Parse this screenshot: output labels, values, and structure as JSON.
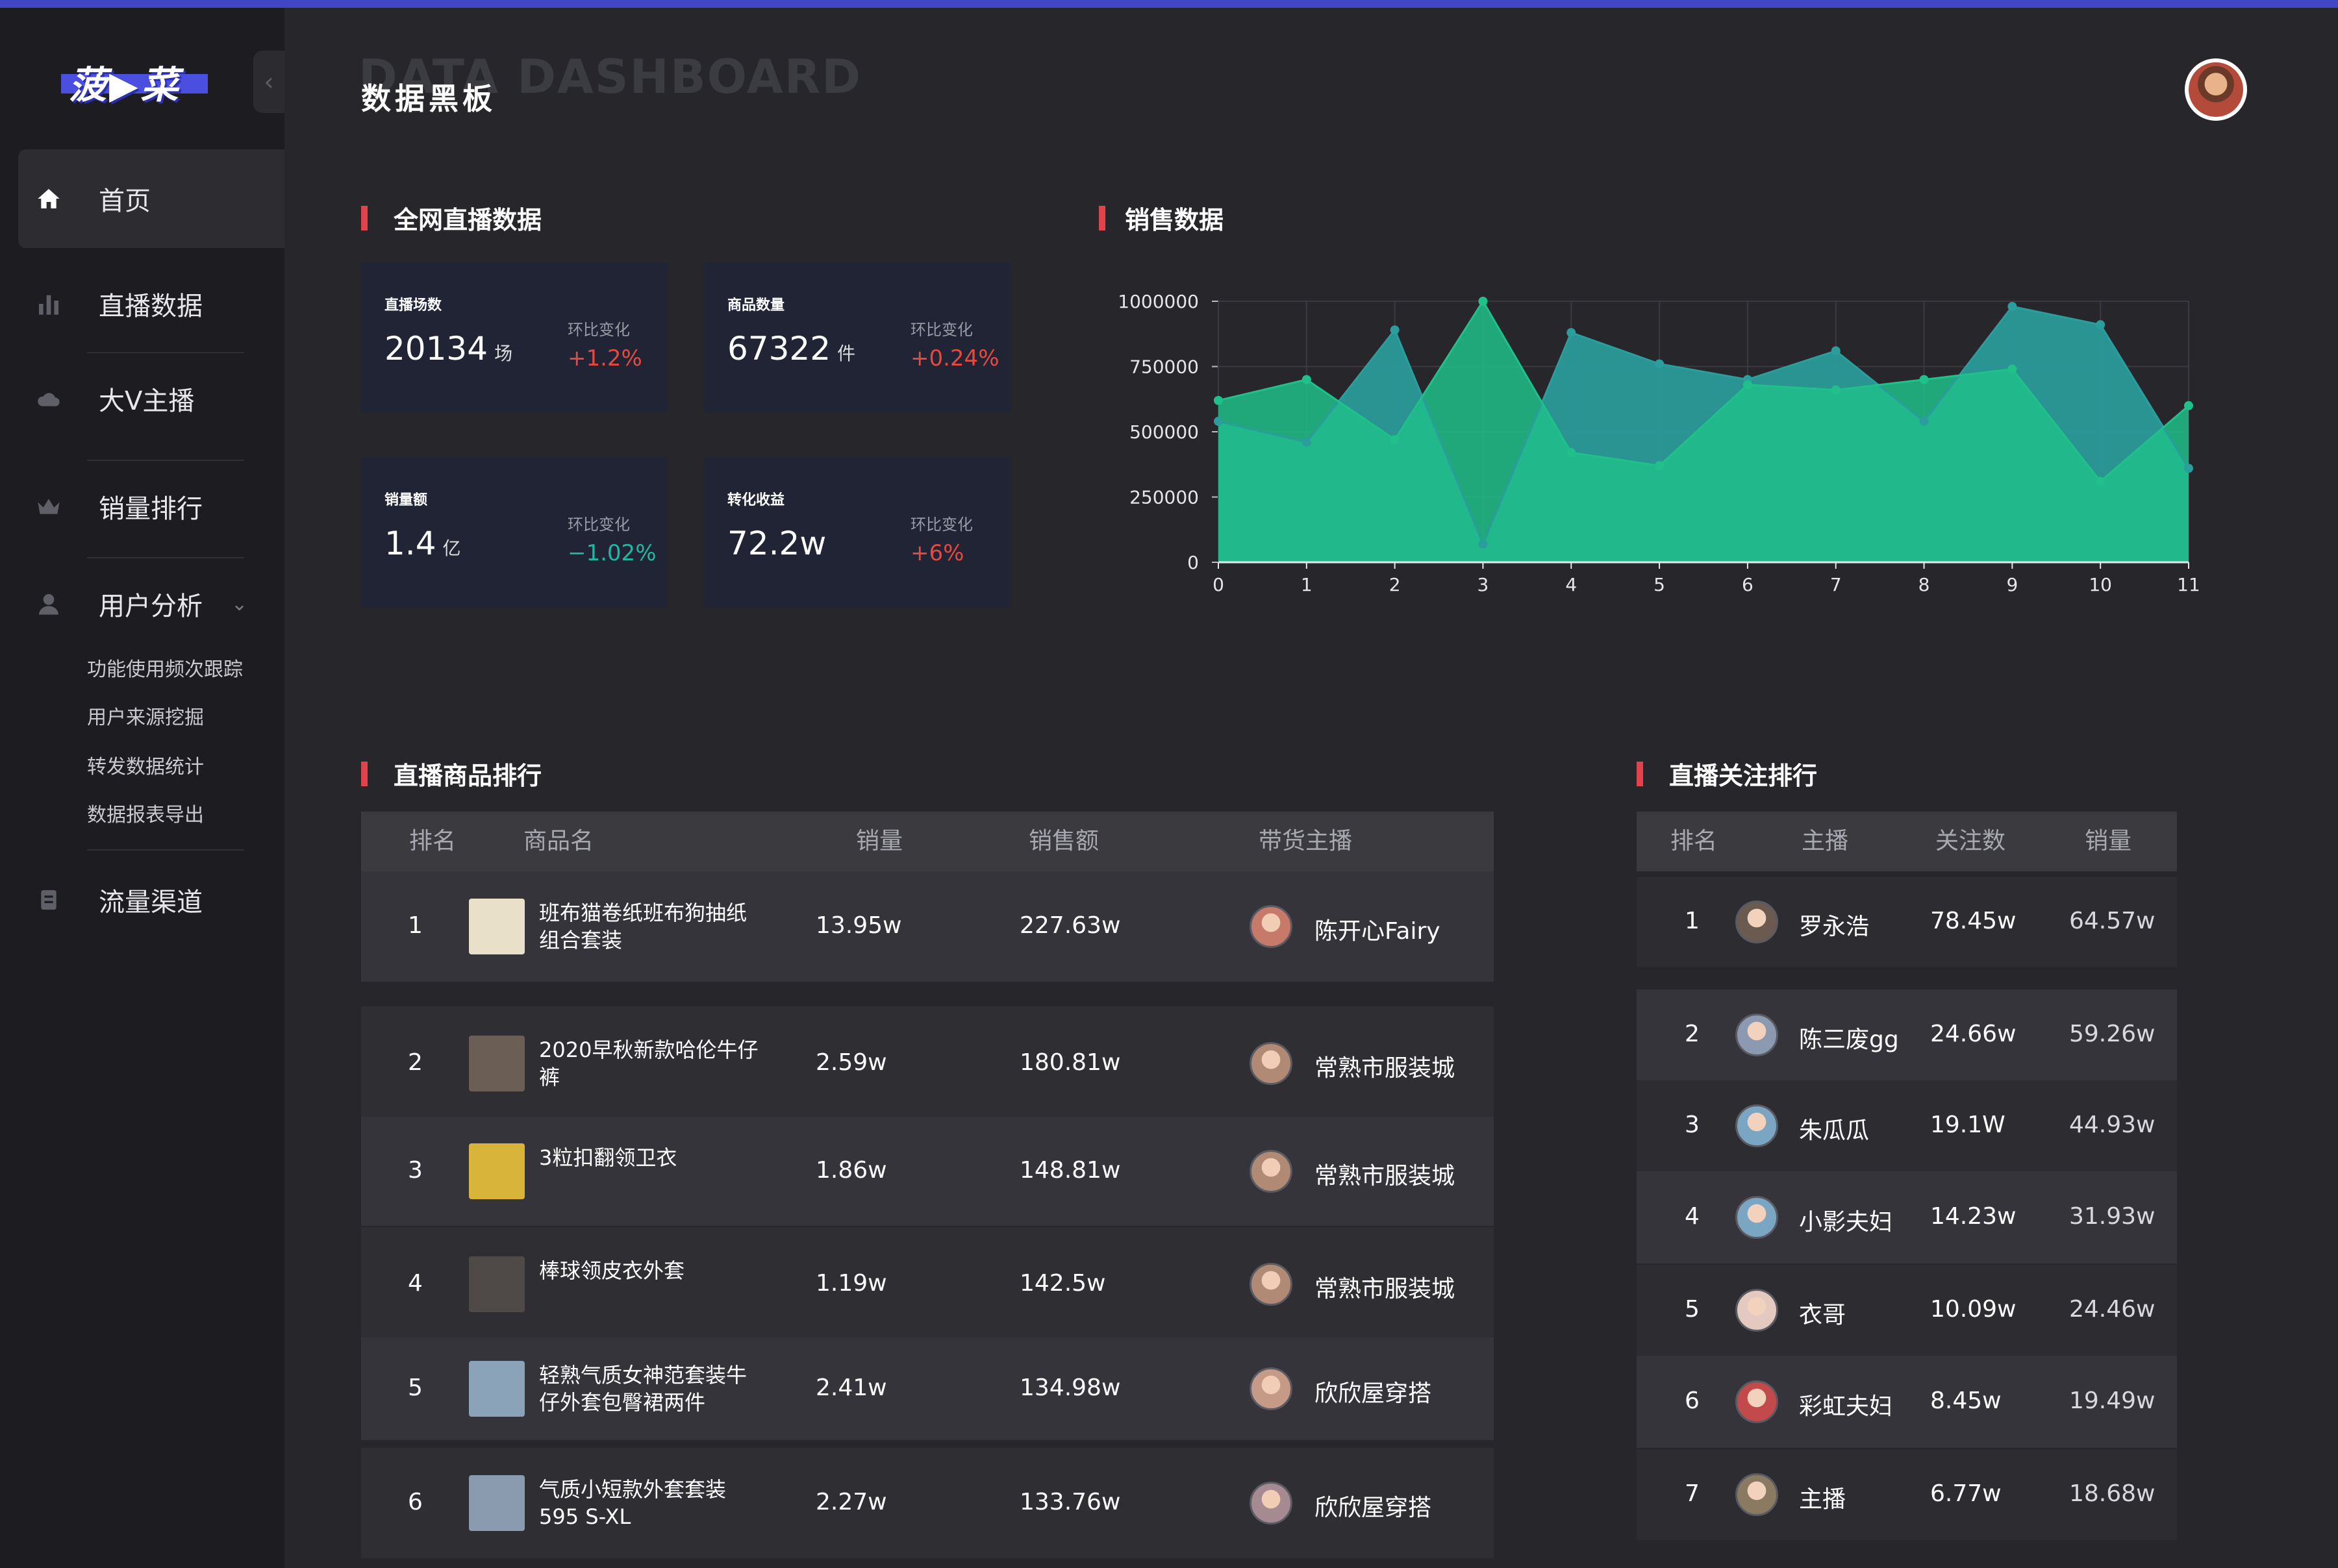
{
  "app": {
    "logo_text": "菠▶菜",
    "header_title": "数据黑板",
    "header_bg_title": "DATA DASHBOARD"
  },
  "sidebar": {
    "items": [
      {
        "label": "首页",
        "icon": "home-icon"
      },
      {
        "label": "直播数据",
        "icon": "bar-chart-icon"
      },
      {
        "label": "大V主播",
        "icon": "cloud-icon"
      },
      {
        "label": "销量排行",
        "icon": "crown-icon"
      },
      {
        "label": "用户分析",
        "icon": "user-icon"
      },
      {
        "label": "流量渠道",
        "icon": "document-icon"
      }
    ],
    "sub_items": [
      "功能使用频次跟踪",
      "用户来源挖掘",
      "转发数据统计",
      "数据报表导出"
    ]
  },
  "sections": {
    "network": "全网直播数据",
    "sales": "销售数据",
    "products": "直播商品排行",
    "follows": "直播关注排行"
  },
  "stats": [
    {
      "label": "直播场数",
      "value": "20134",
      "unit": "场",
      "change_label": "环比变化",
      "change": "+1.2%",
      "trend": "up"
    },
    {
      "label": "商品数量",
      "value": "67322",
      "unit": "件",
      "change_label": "环比变化",
      "change": "+0.24%",
      "trend": "up"
    },
    {
      "label": "销量额",
      "value": "1.4",
      "unit": "亿",
      "change_label": "环比变化",
      "change": "−1.02%",
      "trend": "down"
    },
    {
      "label": "转化收益",
      "value": "72.2w",
      "unit": "",
      "change_label": "环比变化",
      "change": "+6%",
      "trend": "up"
    }
  ],
  "colors": {
    "up": "#e5493f",
    "down": "#1fb9a3",
    "accent": "#e0434b",
    "series_a": "#2a9d9c",
    "series_b": "#20c08a"
  },
  "chart_data": {
    "type": "area",
    "x": [
      0,
      1,
      2,
      3,
      4,
      5,
      6,
      7,
      8,
      9,
      10,
      11
    ],
    "ylim": [
      0,
      1000000
    ],
    "yticks": [
      "1000000",
      "750000",
      "500000",
      "250000",
      "0"
    ],
    "ytick_values": [
      1000000,
      750000,
      500000,
      250000,
      0
    ],
    "grid": true,
    "series": [
      {
        "values": [
          540000,
          460000,
          890000,
          70000,
          880000,
          760000,
          700000,
          810000,
          540000,
          980000,
          910000,
          360000
        ],
        "color": "#2a9d9c"
      },
      {
        "values": [
          620000,
          700000,
          470000,
          1000000,
          420000,
          370000,
          680000,
          660000,
          700000,
          740000,
          310000,
          600000
        ],
        "color": "#20c08a"
      }
    ]
  },
  "product_table": {
    "headers": [
      "排名",
      "商品名",
      "销量",
      "销售额",
      "带货主播"
    ],
    "rows": [
      {
        "rank": "1",
        "name": "班布猫卷纸班布狗抽纸组合套装",
        "sales": "13.95w",
        "revenue": "227.63w",
        "host": "陈开心Fairy"
      },
      {
        "rank": "2",
        "name": "2020早秋新款哈伦牛仔裤",
        "sales": "2.59w",
        "revenue": "180.81w",
        "host": "常熟市服装城"
      },
      {
        "rank": "3",
        "name": "3粒扣翻领卫衣",
        "sales": "1.86w",
        "revenue": "148.81w",
        "host": "常熟市服装城"
      },
      {
        "rank": "4",
        "name": "棒球领皮衣外套",
        "sales": "1.19w",
        "revenue": "142.5w",
        "host": "常熟市服装城"
      },
      {
        "rank": "5",
        "name": "轻熟气质女神范套装牛仔外套包臀裙两件",
        "sales": "2.41w",
        "revenue": "134.98w",
        "host": "欣欣屋穿搭"
      },
      {
        "rank": "6",
        "name": "气质小短款外套套装595 S-XL",
        "sales": "2.27w",
        "revenue": "133.76w",
        "host": "欣欣屋穿搭"
      }
    ]
  },
  "follow_table": {
    "headers": [
      "排名",
      "主播",
      "关注数",
      "销量"
    ],
    "rows": [
      {
        "rank": "1",
        "host": "罗永浩",
        "followers": "78.45w",
        "sales": "64.57w"
      },
      {
        "rank": "2",
        "host": "陈三废gg",
        "followers": "24.66w",
        "sales": "59.26w"
      },
      {
        "rank": "3",
        "host": "朱瓜瓜",
        "followers": "19.1W",
        "sales": "44.93w"
      },
      {
        "rank": "4",
        "host": "小影夫妇",
        "followers": "14.23w",
        "sales": "31.93w"
      },
      {
        "rank": "5",
        "host": "衣哥",
        "followers": "10.09w",
        "sales": "24.46w"
      },
      {
        "rank": "6",
        "host": "彩虹夫妇",
        "followers": "8.45w",
        "sales": "19.49w"
      },
      {
        "rank": "7",
        "host": "主播",
        "followers": "6.77w",
        "sales": "18.68w"
      }
    ]
  }
}
